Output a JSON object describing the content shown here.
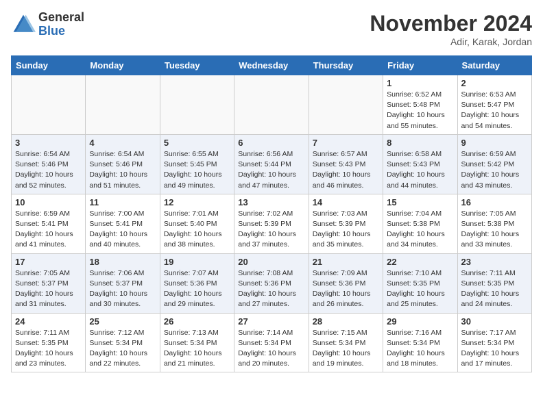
{
  "header": {
    "logo_general": "General",
    "logo_blue": "Blue",
    "month_title": "November 2024",
    "location": "Adir, Karak, Jordan"
  },
  "days_of_week": [
    "Sunday",
    "Monday",
    "Tuesday",
    "Wednesday",
    "Thursday",
    "Friday",
    "Saturday"
  ],
  "weeks": [
    [
      {
        "day": "",
        "info": ""
      },
      {
        "day": "",
        "info": ""
      },
      {
        "day": "",
        "info": ""
      },
      {
        "day": "",
        "info": ""
      },
      {
        "day": "",
        "info": ""
      },
      {
        "day": "1",
        "info": "Sunrise: 6:52 AM\nSunset: 5:48 PM\nDaylight: 10 hours and 55 minutes."
      },
      {
        "day": "2",
        "info": "Sunrise: 6:53 AM\nSunset: 5:47 PM\nDaylight: 10 hours and 54 minutes."
      }
    ],
    [
      {
        "day": "3",
        "info": "Sunrise: 6:54 AM\nSunset: 5:46 PM\nDaylight: 10 hours and 52 minutes."
      },
      {
        "day": "4",
        "info": "Sunrise: 6:54 AM\nSunset: 5:46 PM\nDaylight: 10 hours and 51 minutes."
      },
      {
        "day": "5",
        "info": "Sunrise: 6:55 AM\nSunset: 5:45 PM\nDaylight: 10 hours and 49 minutes."
      },
      {
        "day": "6",
        "info": "Sunrise: 6:56 AM\nSunset: 5:44 PM\nDaylight: 10 hours and 47 minutes."
      },
      {
        "day": "7",
        "info": "Sunrise: 6:57 AM\nSunset: 5:43 PM\nDaylight: 10 hours and 46 minutes."
      },
      {
        "day": "8",
        "info": "Sunrise: 6:58 AM\nSunset: 5:43 PM\nDaylight: 10 hours and 44 minutes."
      },
      {
        "day": "9",
        "info": "Sunrise: 6:59 AM\nSunset: 5:42 PM\nDaylight: 10 hours and 43 minutes."
      }
    ],
    [
      {
        "day": "10",
        "info": "Sunrise: 6:59 AM\nSunset: 5:41 PM\nDaylight: 10 hours and 41 minutes."
      },
      {
        "day": "11",
        "info": "Sunrise: 7:00 AM\nSunset: 5:41 PM\nDaylight: 10 hours and 40 minutes."
      },
      {
        "day": "12",
        "info": "Sunrise: 7:01 AM\nSunset: 5:40 PM\nDaylight: 10 hours and 38 minutes."
      },
      {
        "day": "13",
        "info": "Sunrise: 7:02 AM\nSunset: 5:39 PM\nDaylight: 10 hours and 37 minutes."
      },
      {
        "day": "14",
        "info": "Sunrise: 7:03 AM\nSunset: 5:39 PM\nDaylight: 10 hours and 35 minutes."
      },
      {
        "day": "15",
        "info": "Sunrise: 7:04 AM\nSunset: 5:38 PM\nDaylight: 10 hours and 34 minutes."
      },
      {
        "day": "16",
        "info": "Sunrise: 7:05 AM\nSunset: 5:38 PM\nDaylight: 10 hours and 33 minutes."
      }
    ],
    [
      {
        "day": "17",
        "info": "Sunrise: 7:05 AM\nSunset: 5:37 PM\nDaylight: 10 hours and 31 minutes."
      },
      {
        "day": "18",
        "info": "Sunrise: 7:06 AM\nSunset: 5:37 PM\nDaylight: 10 hours and 30 minutes."
      },
      {
        "day": "19",
        "info": "Sunrise: 7:07 AM\nSunset: 5:36 PM\nDaylight: 10 hours and 29 minutes."
      },
      {
        "day": "20",
        "info": "Sunrise: 7:08 AM\nSunset: 5:36 PM\nDaylight: 10 hours and 27 minutes."
      },
      {
        "day": "21",
        "info": "Sunrise: 7:09 AM\nSunset: 5:36 PM\nDaylight: 10 hours and 26 minutes."
      },
      {
        "day": "22",
        "info": "Sunrise: 7:10 AM\nSunset: 5:35 PM\nDaylight: 10 hours and 25 minutes."
      },
      {
        "day": "23",
        "info": "Sunrise: 7:11 AM\nSunset: 5:35 PM\nDaylight: 10 hours and 24 minutes."
      }
    ],
    [
      {
        "day": "24",
        "info": "Sunrise: 7:11 AM\nSunset: 5:35 PM\nDaylight: 10 hours and 23 minutes."
      },
      {
        "day": "25",
        "info": "Sunrise: 7:12 AM\nSunset: 5:34 PM\nDaylight: 10 hours and 22 minutes."
      },
      {
        "day": "26",
        "info": "Sunrise: 7:13 AM\nSunset: 5:34 PM\nDaylight: 10 hours and 21 minutes."
      },
      {
        "day": "27",
        "info": "Sunrise: 7:14 AM\nSunset: 5:34 PM\nDaylight: 10 hours and 20 minutes."
      },
      {
        "day": "28",
        "info": "Sunrise: 7:15 AM\nSunset: 5:34 PM\nDaylight: 10 hours and 19 minutes."
      },
      {
        "day": "29",
        "info": "Sunrise: 7:16 AM\nSunset: 5:34 PM\nDaylight: 10 hours and 18 minutes."
      },
      {
        "day": "30",
        "info": "Sunrise: 7:17 AM\nSunset: 5:34 PM\nDaylight: 10 hours and 17 minutes."
      }
    ]
  ]
}
